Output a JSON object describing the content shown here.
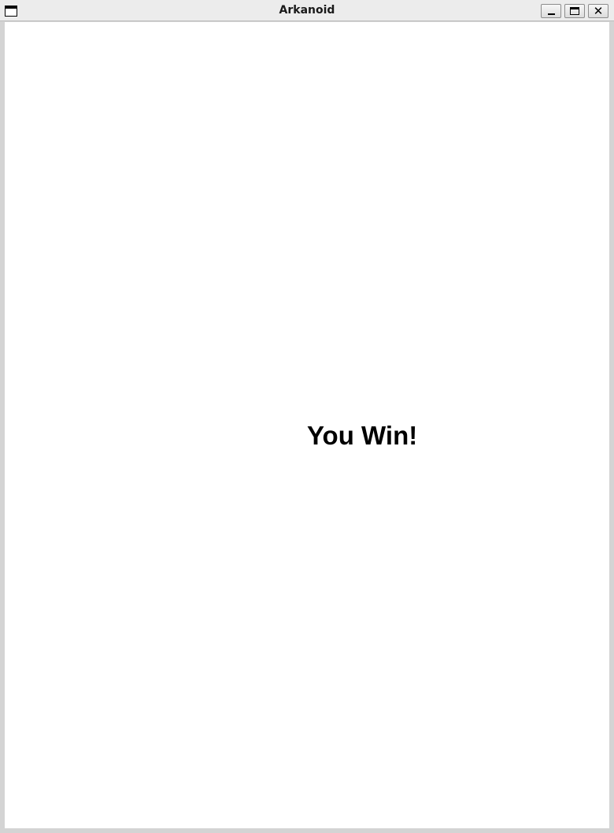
{
  "window": {
    "title": "Arkanoid",
    "icon": "window-icon",
    "controls": {
      "minimize_icon": "minimize-icon",
      "maximize_icon": "maximize-icon",
      "close_icon": "close-icon",
      "close_glyph": "✕"
    }
  },
  "game": {
    "message": "You Win!",
    "background_color": "#ffffff",
    "text_color": "#000000"
  }
}
